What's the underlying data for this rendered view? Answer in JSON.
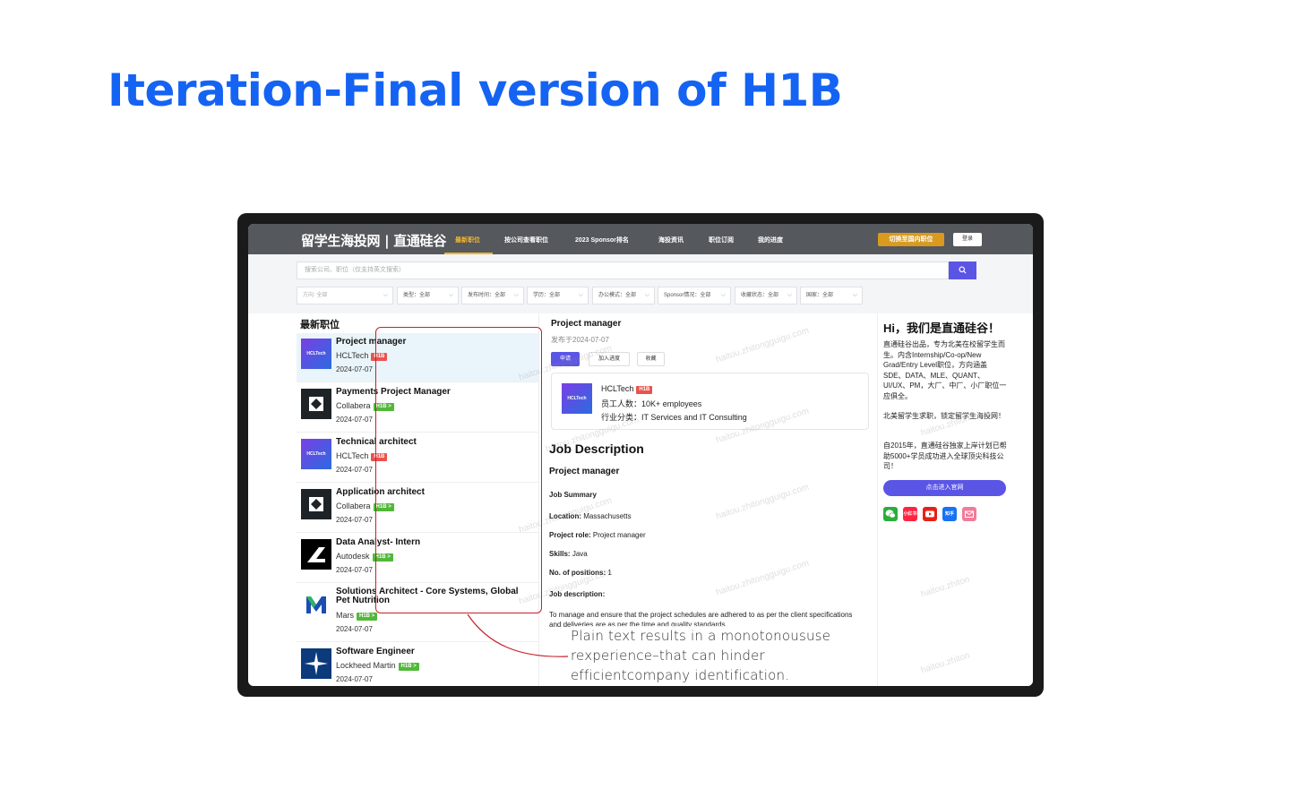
{
  "slide": {
    "title": "Iteration-Final version of H1B"
  },
  "nav": {
    "brand": "留学生海投网 | 直通硅谷",
    "items": [
      "最新职位",
      "按公司查看职位",
      "2023 Sponsor排名",
      "海投资讯",
      "职位订阅",
      "我的进度"
    ],
    "switch_label": "切换至国内职位",
    "login_label": "登录"
  },
  "search": {
    "placeholder": "搜索公司、职位（仅支持英文搜索）",
    "button_icon": "search-icon"
  },
  "filters": [
    "方向: 全部",
    "类型：全部",
    "发布时间：全部",
    "学历：全部",
    "办公模式：全部",
    "Sponsor情况：全部",
    "收藏状态：全部",
    "国家：全部"
  ],
  "list": {
    "heading": "最新职位",
    "jobs": [
      {
        "title": "Project manager",
        "company": "HCLTech",
        "tag": "H1B",
        "date": "2024-07-07",
        "logo_text": "HCLTech"
      },
      {
        "title": "Payments Project Manager",
        "company": "Collabera",
        "tag": "H1B >",
        "date": "2024-07-07"
      },
      {
        "title": "Technical architect",
        "company": "HCLTech",
        "tag": "H1B",
        "date": "2024-07-07",
        "logo_text": "HCLTech"
      },
      {
        "title": "Application architect",
        "company": "Collabera",
        "tag": "H1B >",
        "date": "2024-07-07"
      },
      {
        "title": "Data Analyst- Intern",
        "company": "Autodesk",
        "tag": "H1B >",
        "date": "2024-07-07"
      },
      {
        "title": "Solutions Architect - Core Systems, Global",
        "title2": "Pet Nutrition",
        "company": "Mars",
        "tag": "H1B >",
        "date": "2024-07-07"
      },
      {
        "title": "Software Engineer",
        "company": "Lockheed Martin",
        "tag": "H1B >",
        "date": "2024-07-07"
      }
    ]
  },
  "detail": {
    "title": "Project manager",
    "posted": "发布于2024-07-07",
    "apply_label": "申请",
    "progress_label": "加入进度",
    "favorite_label": "收藏",
    "company": {
      "logo_text": "HCLTech",
      "name": "HCLTech",
      "tag": "H1B",
      "employees": "员工人数：10K+ employees",
      "industry": "行业分类：IT Services and IT Consulting"
    },
    "jd_heading": "Job Description",
    "jd_subtitle": "Project manager",
    "summary_label": "Job Summary",
    "location_label": "Location:",
    "location": "Massachusetts",
    "role_label": "Project role:",
    "role": "Project manager",
    "skills_label": "Skills:",
    "skills": "Java",
    "positions_label": "No. of positions:",
    "positions": "1",
    "desc_label": "Job description:",
    "desc_text": "To manage and ensure that the project schedules are adhered to as per the client specifications and deliveries are as per the time and quality standards."
  },
  "right": {
    "hi": "Hi，我们是直通硅谷！",
    "para1": "直通硅谷出品，专为北美在校留学生而生。内含Internship/Co-op/New Grad/Entry Level职位，方向涵盖SDE、DATA、MLE、QUANT、UI/UX、PM，大厂、中厂、小厂职位一应俱全。",
    "para2": "北美留学生求职，锁定留学生海投网！",
    "para3": "自2015年，直通硅谷独家上岸计划已帮助5000+学员成功进入全球顶尖科技公司！",
    "official_label": "点击进入官网",
    "socials": [
      {
        "icon": "wechat-icon",
        "color": "#2aae3b",
        "text": ""
      },
      {
        "icon": "xiaohongshu-icon",
        "color": "#ff2442",
        "text": "小红书"
      },
      {
        "icon": "youtube-icon",
        "color": "#e62117",
        "text": ""
      },
      {
        "icon": "zhihu-icon",
        "color": "#1772f6",
        "text": "知乎"
      },
      {
        "icon": "email-icon",
        "color": "#f27b9a",
        "text": ""
      }
    ]
  },
  "annotation": {
    "lines": [
      "Plain text results in a monotonoususe",
      "rexperience–that can hinder",
      "efficientcompany identification."
    ]
  },
  "colors": {
    "title_blue": "#1463f3",
    "nav_bg": "#55585c",
    "accent_purple": "#5b55e6",
    "highlight_red": "#c8202a",
    "h1b_red": "#e9534f",
    "h1b_green": "#52b83a"
  }
}
